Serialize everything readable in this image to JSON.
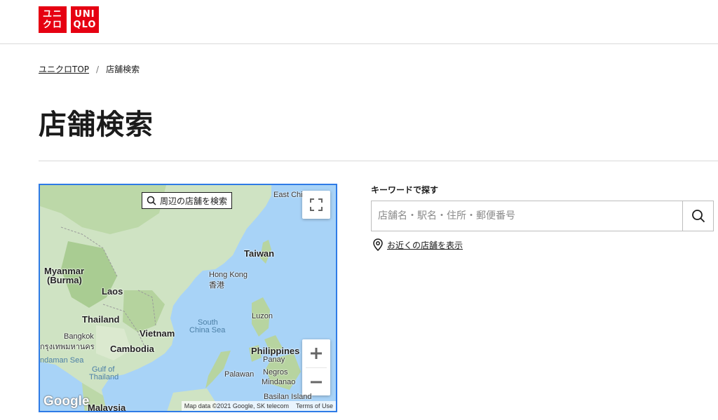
{
  "logo": {
    "left_box": [
      "ユニ",
      "クロ"
    ],
    "right_box": [
      "UNI",
      "QLO"
    ],
    "brand_color": "#e60012"
  },
  "breadcrumb": {
    "home": "ユニクロTOP",
    "separator": "/",
    "current": "店舗検索"
  },
  "page": {
    "title": "店舗検索"
  },
  "map": {
    "search_area_label": "周辺の店舗を検索",
    "labels": {
      "east_china": "East Chi",
      "taiwan": "Taiwan",
      "hong_kong": "Hong Kong",
      "hong_kong_zh": "香港",
      "myanmar": "Myanmar",
      "burma": "(Burma)",
      "laos": "Laos",
      "thailand": "Thailand",
      "vietnam": "Vietnam",
      "bangkok": "Bangkok",
      "bangkok_th": "กรุงเทพมหานคร",
      "cambodia": "Cambodia",
      "south_china_sea": "South",
      "south_china_sea2": "China Sea",
      "luzon": "Luzon",
      "philippines": "Philippines",
      "panay": "Panay",
      "negros": "Negros",
      "mindanao": "Mindanao",
      "palawan": "Palawan",
      "andaman": "ndaman Sea",
      "gulf": "Gulf of",
      "thailand_gulf": "Thailand",
      "basilan": "Basilan Island",
      "malaysia": "Malaysia"
    },
    "google": "Google",
    "attribution": "Map data ©2021 Google, SK telecom",
    "terms": "Terms of Use"
  },
  "search": {
    "label": "キーワードで探す",
    "placeholder": "店舗名・駅名・住所・郵便番号",
    "value": "",
    "nearby_link": "お近くの店舗を表示"
  }
}
